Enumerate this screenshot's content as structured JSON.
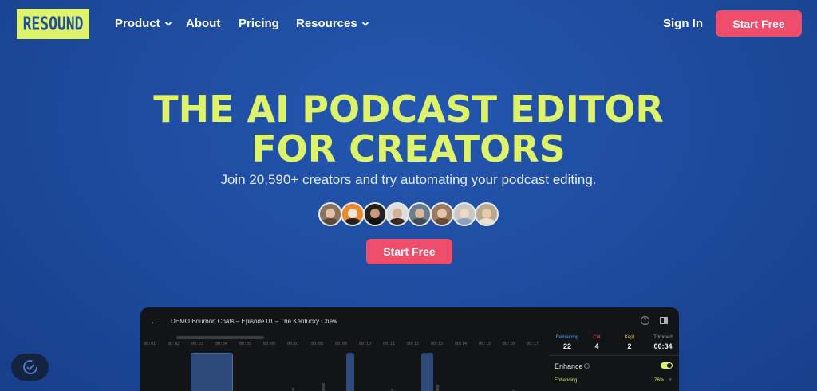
{
  "nav": {
    "logo": "RESOUND",
    "items": [
      {
        "label": "Product",
        "dropdown": true
      },
      {
        "label": "About",
        "dropdown": false
      },
      {
        "label": "Pricing",
        "dropdown": false
      },
      {
        "label": "Resources",
        "dropdown": true
      }
    ],
    "sign_in": "Sign In",
    "start_free": "Start Free"
  },
  "hero": {
    "title_line1": "THE AI PODCAST EDITOR",
    "title_line2": "FOR CREATORS",
    "subtitle": "Join 20,590+ creators and try automating your podcast editing.",
    "cta": "Start Free",
    "avatars": [
      "creator-1",
      "creator-2",
      "creator-3",
      "creator-4",
      "creator-5",
      "creator-6",
      "creator-7",
      "creator-8"
    ]
  },
  "app": {
    "title": "DEMO Bourbon Chats – Episode 01 – The Kentucky Chew",
    "help_glyph": "?",
    "timeline": [
      "00:01",
      "00:02",
      "00:03",
      "00:04",
      "00:05",
      "00:06",
      "00:07",
      "00:08",
      "00:09",
      "00:10",
      "00:11",
      "00:12",
      "00:13",
      "00:14",
      "00:15",
      "00:16",
      "00:17"
    ],
    "stats": [
      {
        "label": "Remaining",
        "value": "22",
        "color": "#4fa3ff"
      },
      {
        "label": "Cut",
        "value": "4",
        "color": "#ff5a5a"
      },
      {
        "label": "Kept",
        "value": "2",
        "color": "#e8d94a"
      },
      {
        "label": "Trimmed",
        "value": "00:34",
        "color": "#9aa0a6"
      }
    ],
    "enhance_label": "Enhance",
    "enhance_on": true,
    "enhancing_text": "Enhancing...",
    "enhancing_percent": "76%",
    "close_glyph": "×"
  },
  "colors": {
    "background": "#1f4d9e",
    "accent_lime": "#dff36a",
    "cta_pink": "#ee4d6b",
    "app_bg": "#121416"
  }
}
